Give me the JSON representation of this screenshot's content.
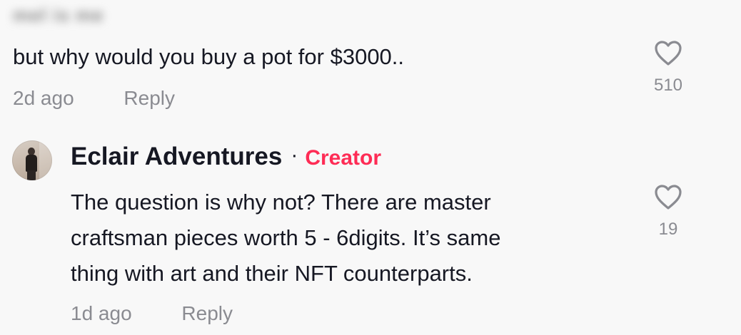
{
  "comment_1": {
    "author_blurred": "mel is me",
    "text": "but why would you buy a pot for $3000..",
    "time": "2d ago",
    "reply_label": "Reply",
    "like_count": "510",
    "like_icon": "heart-outline-icon"
  },
  "comment_2": {
    "author": "Eclair Adventures",
    "separator": "·",
    "badge": "Creator",
    "text_lines": [
      "The question is why not? There are master",
      "craftsman pieces worth 5 - 6digits. It’s same",
      "thing with art and their NFT counterparts."
    ],
    "time": "1d ago",
    "reply_label": "Reply",
    "like_count": "19",
    "like_icon": "heart-outline-icon"
  },
  "colors": {
    "background": "#f8f8f8",
    "text": "#161823",
    "muted": "#8a8b91",
    "creator_accent": "#fe2c55"
  }
}
